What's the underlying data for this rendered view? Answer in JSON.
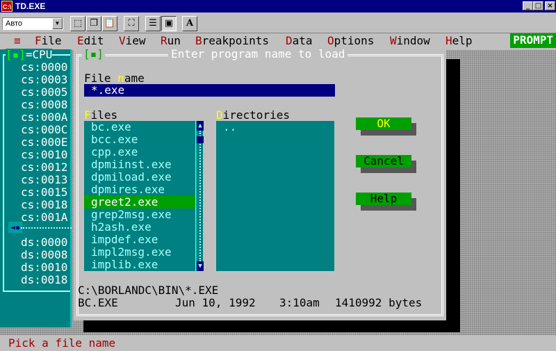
{
  "window": {
    "app_icon": "C:\\",
    "title": "TD.EXE",
    "buttons": {
      "minimize": "_",
      "maximize": "□",
      "close": "×"
    }
  },
  "toolbar": {
    "font_select": "Авто",
    "buttons": [
      "mark-icon",
      "copy-icon",
      "paste-icon",
      "fullscreen-icon",
      "properties-icon",
      "background-icon",
      "font-icon"
    ],
    "font_button_label": "A"
  },
  "menubar": {
    "items": [
      {
        "hotkey": "≡",
        "rest": ""
      },
      {
        "hotkey": "F",
        "rest": "ile"
      },
      {
        "hotkey": "E",
        "rest": "dit"
      },
      {
        "hotkey": "V",
        "rest": "iew"
      },
      {
        "hotkey": "R",
        "rest": "un"
      },
      {
        "hotkey": "B",
        "rest": "reakpoints"
      },
      {
        "hotkey": "D",
        "rest": "ata"
      },
      {
        "hotkey": "O",
        "rest": "ptions"
      },
      {
        "hotkey": "W",
        "rest": "indow"
      },
      {
        "hotkey": "H",
        "rest": "elp"
      }
    ],
    "prompt": "PROMPT"
  },
  "cpu_window": {
    "title": "=CPU",
    "close": "[▪]",
    "lines": [
      "cs:0000",
      "cs:0003",
      "cs:0005",
      "cs:0008",
      "cs:000A",
      "cs:000C",
      "cs:000E",
      "cs:0010",
      "cs:0012",
      "cs:0013",
      "cs:0015",
      "cs:0018",
      "cs:001A"
    ],
    "data_lines": [
      "ds:0000",
      "ds:0008",
      "ds:0010",
      "ds:0018"
    ],
    "marker": "◄▪"
  },
  "dialog": {
    "close": "[▪]",
    "title": "Enter program name to load",
    "file_name_label": {
      "pre": "File ",
      "hotkey": "n",
      "post": "ame"
    },
    "file_name_value": "*.exe",
    "files_label": {
      "hotkey": "F",
      "post": "iles"
    },
    "directories_label": {
      "hotkey": "D",
      "post": "irectories"
    },
    "files": [
      "bc.exe",
      "bcc.exe",
      "cpp.exe",
      "dpmiinst.exe",
      "dpmiload.exe",
      "dpmires.exe",
      "greet2.exe",
      "grep2msg.exe",
      "h2ash.exe",
      "impdef.exe",
      "impl2msg.exe",
      "implib.exe"
    ],
    "selected_file_index": 6,
    "directories": [
      ".."
    ],
    "scroll": {
      "up": "▲",
      "down": "▼"
    },
    "buttons": {
      "ok": "OK",
      "cancel": "Cancel",
      "help": "Help"
    },
    "path": "C:\\BORLANDC\\BIN\\*.EXE",
    "info": {
      "name": "BC.EXE",
      "date": "Jun 10, 1992",
      "time": "3:10am",
      "size": "1410992 bytes"
    }
  },
  "status": "Pick a file name"
}
